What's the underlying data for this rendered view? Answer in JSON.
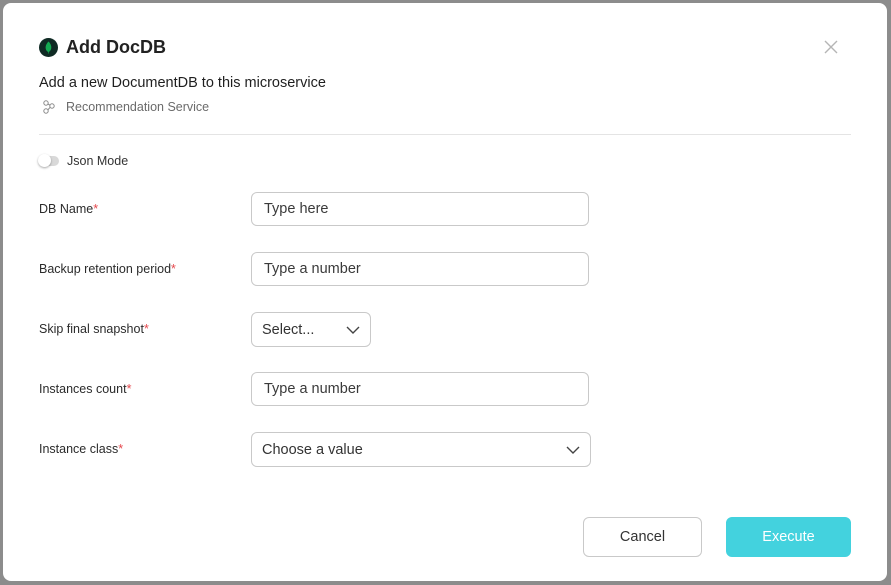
{
  "dialog": {
    "title": "Add DocDB",
    "subtitle": "Add a new DocumentDB to this microservice",
    "service_name": "Recommendation Service"
  },
  "json_mode": {
    "label": "Json Mode",
    "enabled": false
  },
  "form": {
    "required_mark": "*",
    "fields": [
      {
        "label": "DB Name",
        "type": "text",
        "placeholder": "Type here",
        "value": ""
      },
      {
        "label": "Backup retention period",
        "type": "number",
        "placeholder": "Type a number",
        "value": ""
      },
      {
        "label": "Skip final snapshot",
        "type": "select",
        "selected": "Select..."
      },
      {
        "label": "Instances count",
        "type": "number",
        "placeholder": "Type a number",
        "value": ""
      },
      {
        "label": "Instance class",
        "type": "select",
        "selected": "Choose a value"
      }
    ]
  },
  "buttons": {
    "cancel": "Cancel",
    "execute": "Execute"
  },
  "colors": {
    "accent": "#43d2de",
    "required": "#e5484d",
    "logo_bg": "#0f2a24",
    "logo_leaf": "#13aa52"
  },
  "icons": {
    "logo": "mongodb-leaf-icon",
    "close": "close-icon",
    "service": "microservice-icon",
    "dropdown": "chevron-down-icon"
  }
}
